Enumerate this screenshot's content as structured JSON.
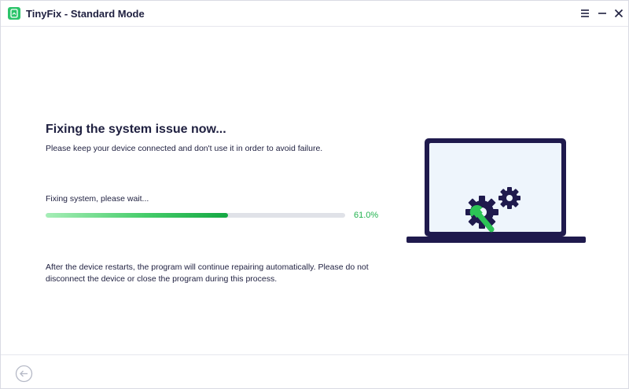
{
  "window": {
    "title": "TinyFix - Standard Mode",
    "logo_icon": "tinyfix-logo-icon",
    "controls": [
      "menu-icon",
      "minimize-icon",
      "close-icon"
    ]
  },
  "main": {
    "heading": "Fixing the system issue now...",
    "subtitle": "Please keep your device connected and don't use it in order to avoid failure.",
    "progress": {
      "label": "Fixing system, please wait...",
      "value": 61.0,
      "percent_text": "61.0%"
    },
    "note": "After the device restarts, the program will continue repairing automatically. Please do not disconnect the device or close the program during this process.",
    "illustration": "laptop-repair-gears-wrench-icon"
  },
  "footer": {
    "back_icon": "back-arrow-icon"
  },
  "colors": {
    "accent_green": "#22b34f",
    "dark_navy": "#1f1a4d",
    "screen_bg": "#eef5fc",
    "track": "#e0e2e8"
  }
}
